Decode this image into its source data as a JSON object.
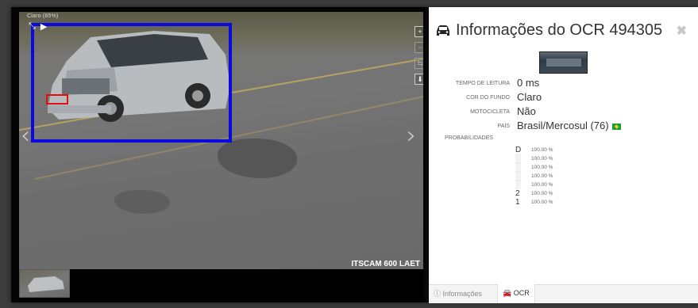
{
  "camera": {
    "overlay_text": "Claro (85%)",
    "device_label": "ITSCAM 600 LAET"
  },
  "viewer": {
    "tools": [
      "zoom-in-icon",
      "zoom-out-icon",
      "swap-icon",
      "download-icon"
    ]
  },
  "panel": {
    "title": "Informações do OCR 494305",
    "fields": [
      {
        "label": "TEMPO DE LEITURA",
        "value": "0 ms"
      },
      {
        "label": "COR DO FUNDO",
        "value": "Claro"
      },
      {
        "label": "MOTOCICLETA",
        "value": "Não"
      },
      {
        "label": "PAÍS",
        "value": "Brasil/Mercosul (76)"
      }
    ],
    "probabilities_label": "PROBABILIDADES",
    "probabilities": [
      {
        "char": "D",
        "value": "100.00 %"
      },
      {
        "char": "",
        "value": "100.00 %"
      },
      {
        "char": "",
        "value": "100.00 %"
      },
      {
        "char": "",
        "value": "100.00 %"
      },
      {
        "char": "",
        "value": "100.00 %"
      },
      {
        "char": "2",
        "value": "100.00 %"
      },
      {
        "char": "1",
        "value": "100.00 %"
      }
    ],
    "tabs": [
      {
        "label": "Informações",
        "icon": "info-circle-icon",
        "active": false
      },
      {
        "label": "OCR",
        "icon": "car-icon",
        "active": true
      }
    ]
  },
  "colors": {
    "roi_box": "#0a0ae0",
    "plate_box": "#e01010",
    "flag_green": "#1f9a3b"
  }
}
